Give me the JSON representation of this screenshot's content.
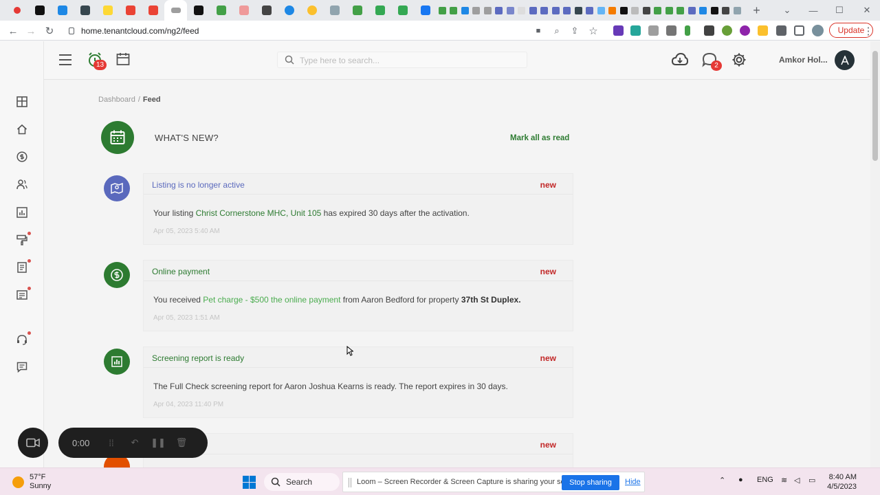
{
  "browser": {
    "url": "home.tenantcloud.com/ng2/feed",
    "update_label": "Update",
    "new_tab_label": "+"
  },
  "app": {
    "search_placeholder": "Type here to search...",
    "notification_count": "13",
    "messages_count": "2",
    "account_name": "Amkor Hol..."
  },
  "breadcrumb": {
    "home": "Dashboard",
    "separator": "/",
    "current": "Feed"
  },
  "feed": {
    "title": "WHAT'S NEW?",
    "mark_all_label": "Mark all as read",
    "items": [
      {
        "title": "Listing is no longer active",
        "badge": "new",
        "body_pre": "Your listing ",
        "body_link": "Christ Cornerstone MHC, Unit 105",
        "body_post": " has expired 30 days after the activation.",
        "date": "Apr 05, 2023 5:40 AM",
        "icon": "map-pin-icon",
        "color": "#5c6bc0"
      },
      {
        "title": "Online payment",
        "badge": "new",
        "body_pre": "You received ",
        "body_link": "Pet charge - $500 the online payment",
        "body_mid": " from Aaron Bedford for property ",
        "body_bold": "37th St Duplex.",
        "date": "Apr 05, 2023 1:51 AM",
        "icon": "dollar-icon",
        "color": "#2e7d32"
      },
      {
        "title": "Screening report is ready",
        "badge": "new",
        "body": "The Full Check screening report for Aaron Joshua Kearns is ready. The report expires in 30 days.",
        "date": "Apr 04, 2023 11:40 PM",
        "icon": "report-icon",
        "color": "#2e7d32"
      },
      {
        "badge": "new"
      }
    ]
  },
  "recorder": {
    "time": "0:00"
  },
  "taskbar": {
    "temp": "57°F",
    "weather": "Sunny",
    "search_label": "Search",
    "share_message": "Loom – Screen Recorder & Screen Capture is sharing your screen.",
    "stop_label": "Stop sharing",
    "hide_label": "Hide",
    "lang": "ENG",
    "time": "8:40 AM",
    "date": "4/5/2023"
  }
}
